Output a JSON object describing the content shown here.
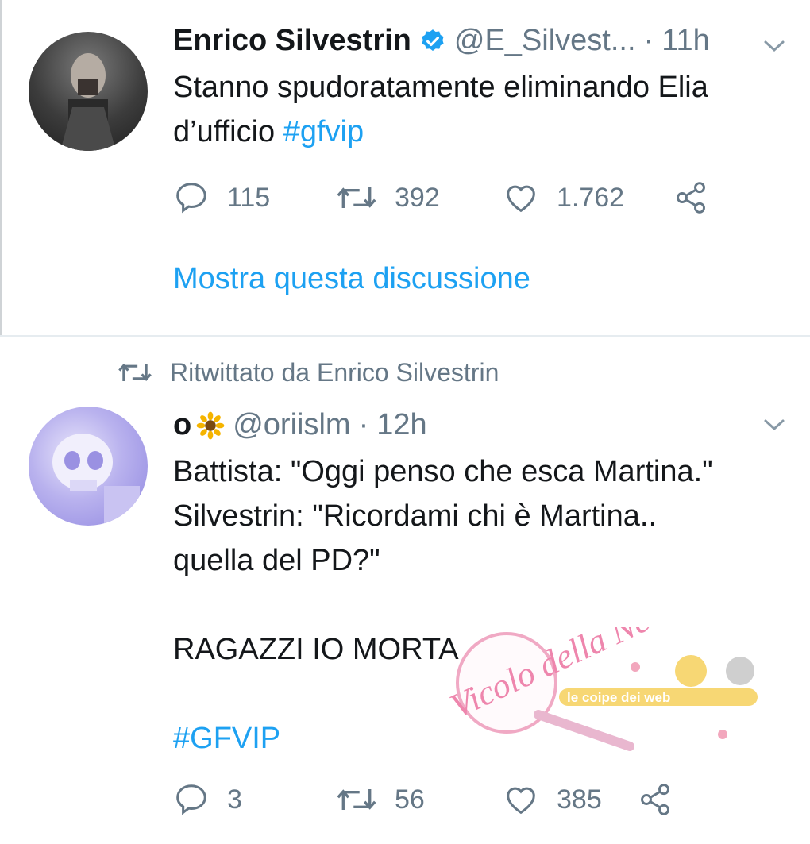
{
  "tweet1": {
    "display_name": "Enrico Silvestrin",
    "handle": "@E_Silvest...",
    "separator": "·",
    "time": "11h",
    "text_line1": "Stanno spudoratamente eliminando Elia",
    "text_line2_prefix": "d’ufficio ",
    "hashtag": "#gfvip",
    "replies": "115",
    "retweets": "392",
    "likes": "1.762",
    "show_thread": "Mostra questa discussione"
  },
  "retweet_notice": "Ritwittato da Enrico Silvestrin",
  "tweet2": {
    "display_name": "o",
    "handle": "@oriislm",
    "separator": "·",
    "time": "12h",
    "line1": "Battista: \"Oggi penso che esca Martina.\"",
    "line2": "Silvestrin: \"Ricordami chi è Martina..",
    "line3": "quella del PD?\"",
    "line4": "RAGAZZI IO MORTA",
    "hashtag": "#GFVIP",
    "replies": "3",
    "retweets": "56",
    "likes": "385"
  },
  "watermark": {
    "left_logo": "Vicolo della News",
    "right_logo": "le coipe dei web"
  },
  "colors": {
    "accent": "#1da1f2",
    "muted": "#657786",
    "text": "#14171a"
  }
}
